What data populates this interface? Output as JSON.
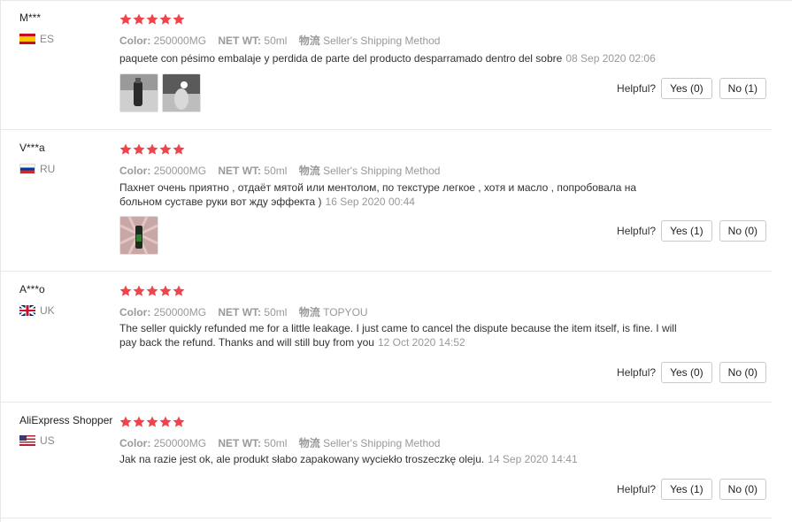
{
  "labels": {
    "color": "Color:",
    "net_wt": "NET WT:",
    "logistics": "物流",
    "helpful": "Helpful?"
  },
  "colors": {
    "star": "#f0444c",
    "meta_text": "#999999",
    "border": "#e8e8e8"
  },
  "reviews": [
    {
      "user": "M***",
      "country": "ES",
      "flag_icon": "spain-flag-icon",
      "rating": 5,
      "color_value": "250000MG",
      "net_wt_value": "50ml",
      "logistics_value": "Seller's Shipping Method",
      "feedback": "paquete con pésimo embalaje y perdida de parte del producto desparramado dentro del sobre",
      "date": "08 Sep 2020 02:06",
      "images": [
        "review-photo-1",
        "review-photo-2"
      ],
      "yes": "Yes (0)",
      "no": "No (1)"
    },
    {
      "user": "V***a",
      "country": "RU",
      "flag_icon": "russia-flag-icon",
      "rating": 5,
      "color_value": "250000MG",
      "net_wt_value": "50ml",
      "logistics_value": "Seller's Shipping Method",
      "feedback": "Пахнет очень приятно , отдаёт мятой или ментолом, по текстуре легкое , хотя и масло , попробовала на больном суставе руки вот жду эффекта )",
      "date": "16 Sep 2020 00:44",
      "images": [
        "review-photo-1"
      ],
      "yes": "Yes (1)",
      "no": "No (0)"
    },
    {
      "user": "A***o",
      "country": "UK",
      "flag_icon": "uk-flag-icon",
      "rating": 5,
      "color_value": "250000MG",
      "net_wt_value": "50ml",
      "logistics_value": "TOPYOU",
      "feedback": "The seller quickly refunded me for a little leakage. I just came to cancel the dispute because the item itself, is fine. I will pay back the refund. Thanks and will still buy from you",
      "date": "12 Oct 2020 14:52",
      "images": [],
      "yes": "Yes (0)",
      "no": "No (0)"
    },
    {
      "user": "AliExpress Shopper",
      "country": "US",
      "flag_icon": "us-flag-icon",
      "rating": 5,
      "color_value": "250000MG",
      "net_wt_value": "50ml",
      "logistics_value": "Seller's Shipping Method",
      "feedback": "Jak na razie jest ok, ale produkt słabo zapakowany wyciekło troszeczkę oleju.",
      "date": "14 Sep 2020 14:41",
      "images": [],
      "yes": "Yes (1)",
      "no": "No (0)"
    }
  ]
}
